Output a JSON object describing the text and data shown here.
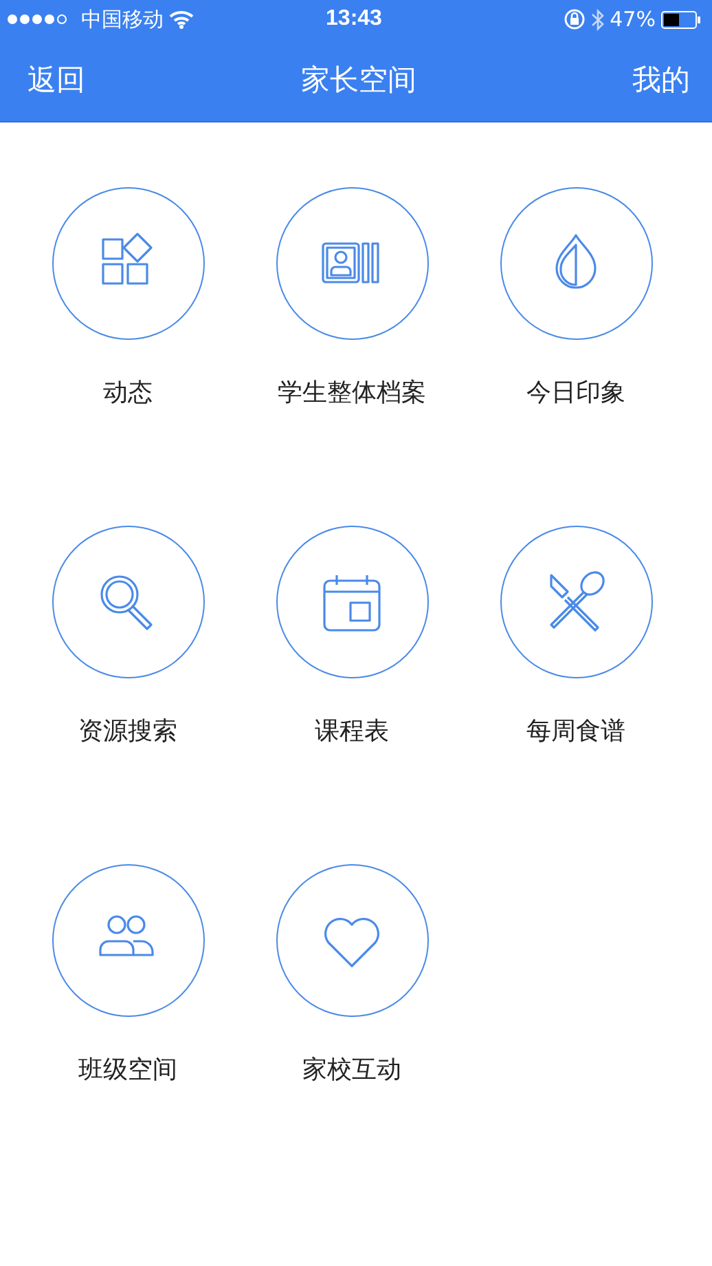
{
  "status_bar": {
    "carrier": "中国移动",
    "time": "13:43",
    "battery": "47%"
  },
  "nav": {
    "back": "返回",
    "title": "家长空间",
    "right": "我的"
  },
  "features": [
    {
      "label": "动态",
      "kind": "blocks"
    },
    {
      "label": "学生整体档案",
      "kind": "profile"
    },
    {
      "label": "今日印象",
      "kind": "drop"
    },
    {
      "label": "资源搜索",
      "kind": "search"
    },
    {
      "label": "课程表",
      "kind": "calendar"
    },
    {
      "label": "每周食谱",
      "kind": "cutlery"
    },
    {
      "label": "班级空间",
      "kind": "people"
    },
    {
      "label": "家校互动",
      "kind": "heart"
    }
  ]
}
